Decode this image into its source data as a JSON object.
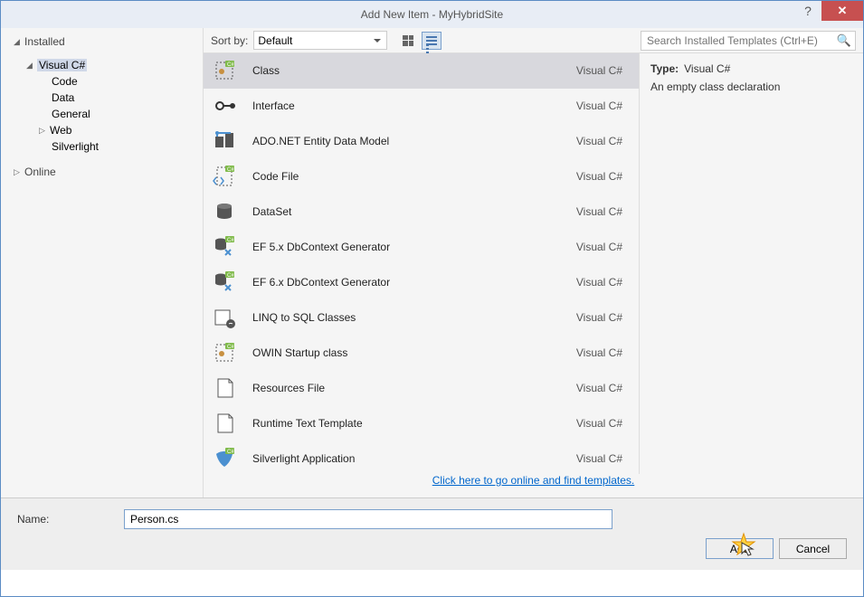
{
  "title": "Add New Item - MyHybridSite",
  "sidebar": {
    "installed": "Installed",
    "csharp": "Visual C#",
    "code": "Code",
    "data": "Data",
    "general": "General",
    "web": "Web",
    "silverlight": "Silverlight",
    "online": "Online"
  },
  "toolbar": {
    "sort_label": "Sort by:",
    "sort_value": "Default",
    "search_placeholder": "Search Installed Templates (Ctrl+E)"
  },
  "templates": [
    {
      "name": "Class",
      "lang": "Visual C#",
      "selected": true,
      "icon": "class"
    },
    {
      "name": "Interface",
      "lang": "Visual C#",
      "icon": "interface"
    },
    {
      "name": "ADO.NET Entity Data Model",
      "lang": "Visual C#",
      "icon": "entity"
    },
    {
      "name": "Code File",
      "lang": "Visual C#",
      "icon": "codefile"
    },
    {
      "name": "DataSet",
      "lang": "Visual C#",
      "icon": "dataset"
    },
    {
      "name": "EF 5.x DbContext Generator",
      "lang": "Visual C#",
      "icon": "ef"
    },
    {
      "name": "EF 6.x DbContext Generator",
      "lang": "Visual C#",
      "icon": "ef"
    },
    {
      "name": "LINQ to SQL Classes",
      "lang": "Visual C#",
      "icon": "linq"
    },
    {
      "name": "OWIN Startup class",
      "lang": "Visual C#",
      "icon": "class"
    },
    {
      "name": "Resources File",
      "lang": "Visual C#",
      "icon": "resfile"
    },
    {
      "name": "Runtime Text Template",
      "lang": "Visual C#",
      "icon": "resfile"
    },
    {
      "name": "Silverlight Application",
      "lang": "Visual C#",
      "icon": "sl"
    },
    {
      "name": "",
      "lang": "",
      "icon": "sl"
    }
  ],
  "detail": {
    "type_label": "Type:",
    "type_value": "Visual C#",
    "desc": "An empty class declaration"
  },
  "online_link": "Click here to go online and find templates.",
  "bottom": {
    "name_label": "Name:",
    "name_value": "Person.cs",
    "add": "Add",
    "cancel": "Cancel"
  }
}
